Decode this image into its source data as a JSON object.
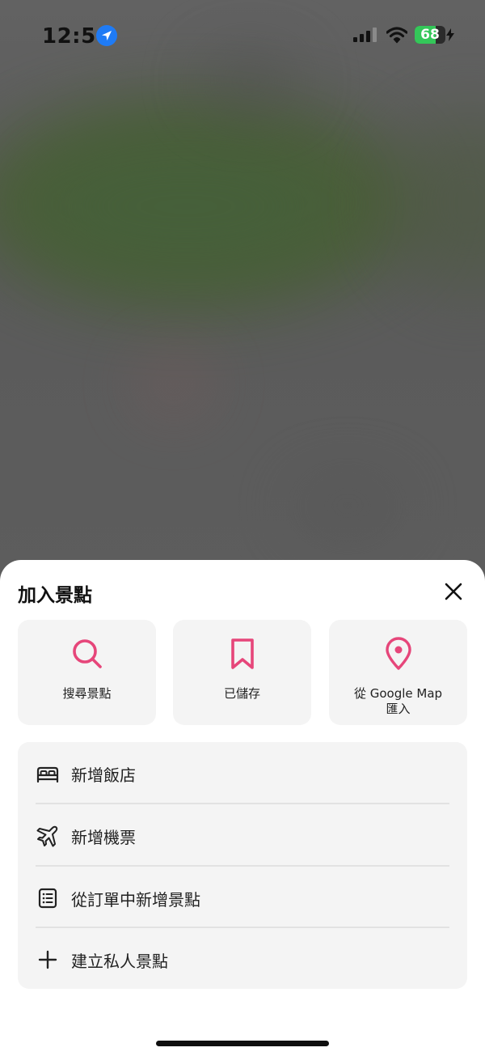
{
  "status_bar": {
    "time": "12:50",
    "battery_level": "68",
    "battery_fraction": 0.68,
    "battery_color": "#34c759",
    "location_icon_color": "#1f7bf5"
  },
  "sheet": {
    "title": "加入景點",
    "close_icon": "close-icon",
    "accent_color": "#e6467a",
    "cards": [
      {
        "icon": "search-icon",
        "label": "搜尋景點"
      },
      {
        "icon": "bookmark-icon",
        "label": "已儲存"
      },
      {
        "icon": "map-pin-icon",
        "label_line1": "從 Google Map",
        "label_line2": "匯入"
      }
    ],
    "menu": [
      {
        "icon": "bed-icon",
        "label": "新增飯店"
      },
      {
        "icon": "airplane-icon",
        "label": "新增機票"
      },
      {
        "icon": "receipt-list-icon",
        "label": "從訂單中新增景點"
      },
      {
        "icon": "plus-icon",
        "label": "建立私人景點"
      }
    ]
  }
}
